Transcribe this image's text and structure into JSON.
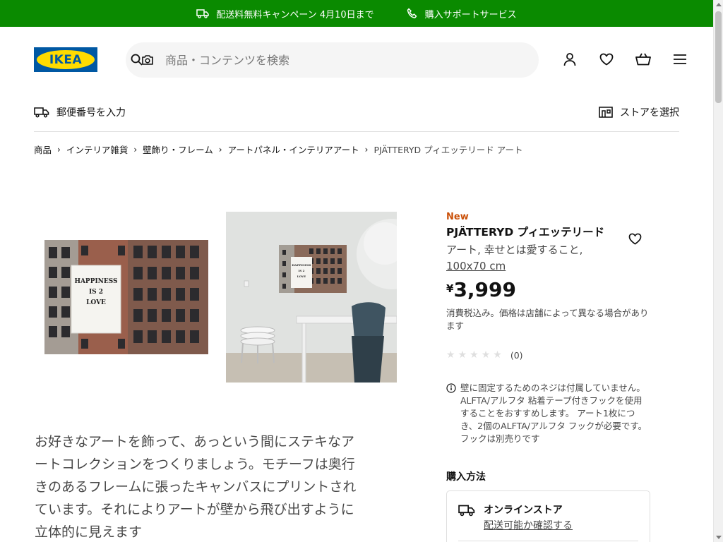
{
  "topbar": {
    "shipping_campaign": "配送料無料キャンペーン 4月10日まで",
    "support": "購入サポートサービス",
    "bg_color": "#0a8a00"
  },
  "header": {
    "logo_text": "IKEA",
    "search_placeholder": "商品・コンテンツを検索",
    "icons": [
      "user-icon",
      "heart-icon",
      "cart-icon",
      "menu-icon"
    ]
  },
  "subnav": {
    "postal": "郵便番号を入力",
    "store": "ストアを選択"
  },
  "breadcrumb": {
    "items": [
      "商品",
      "インテリア雑貨",
      "壁飾り・フレーム",
      "アートパネル・インテリアアート"
    ],
    "current": "PJÄTTERYD プィエッテリード アート"
  },
  "artwork": {
    "line1": "HAPPINESS",
    "line2": "IS 2",
    "line3": "LOVE"
  },
  "description": "お好きなアートを飾って、あっという間にステキなアートコレクションをつくりましょう。モチーフは奥行きのあるフレームに張ったキャンバスにプリントされています。それによりアートが壁から飛び出すように立体的に見えます",
  "product": {
    "badge": "New",
    "name": "PJÄTTERYD プィエッテリード",
    "type": "アート, 幸せとは愛すること,",
    "size": "100x70 cm",
    "currency": "¥",
    "price": "3,999",
    "tax_note": "消費税込み。価格は店舗によって異なる場合があります",
    "rating_count": "(0)",
    "rating_stars": 0,
    "notice": "壁に固定するためのネジは付属していません。ALFTA/アルフタ 粘着テープ付きフックを使用することをおすすめします。 アート1枚につき、2個のALFTA/アルフタ フックが必要です。 フックは別売りです"
  },
  "purchase": {
    "title": "購入方法",
    "online_store": "オンラインストア",
    "check_delivery": "配送可能か確認する"
  }
}
